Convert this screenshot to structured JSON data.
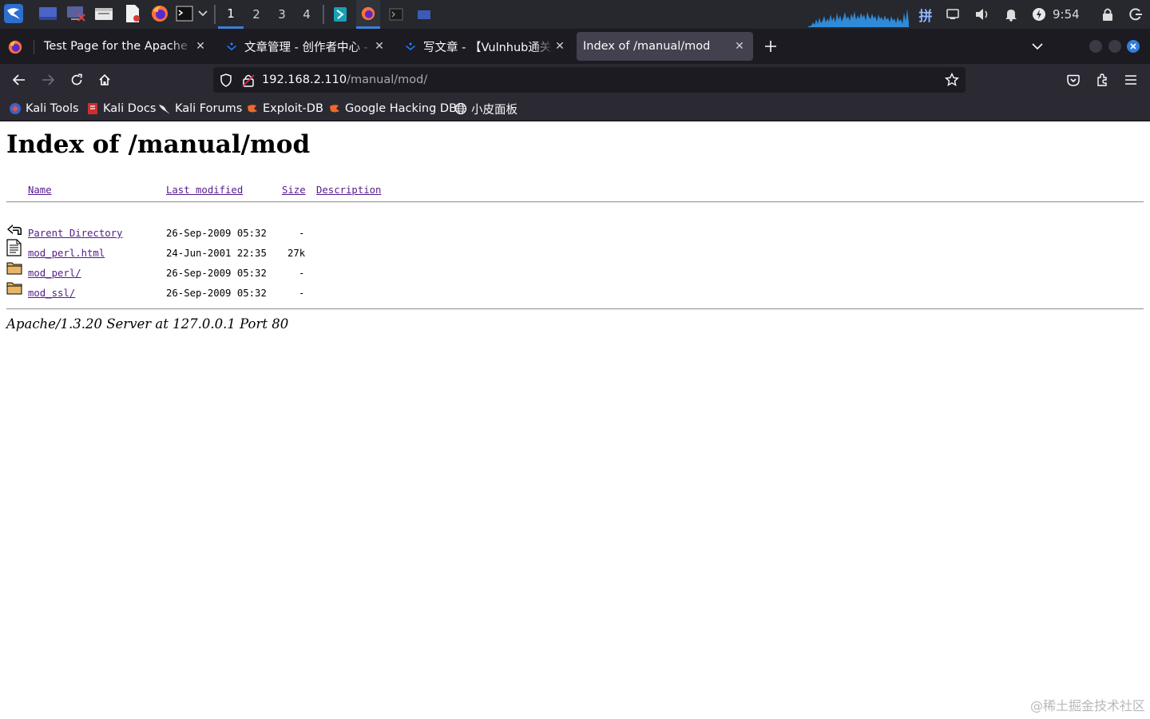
{
  "panel": {
    "workspaces": [
      "1",
      "2",
      "3",
      "4"
    ],
    "active_workspace": "1",
    "clock": "9:54",
    "launchers": [
      "kali-menu-icon",
      "show-desktop-icon",
      "remote-desktop-icon",
      "file-manager-icon",
      "text-editor-icon",
      "firefox-icon",
      "terminal-icon",
      "chevron-down-icon"
    ],
    "tray": [
      "input-method-icon",
      "display-icon",
      "volume-icon",
      "notification-bell-icon",
      "power-icon",
      "lock-icon",
      "logout-icon"
    ],
    "input_method_label": "拼",
    "accent": "#3d7fd6"
  },
  "tabs": [
    {
      "label": "Test Page for the Apache Web Server",
      "icon": "firefox-icon",
      "active": false
    },
    {
      "label": "文章管理 - 创作者中心 - 掘金",
      "icon": "juejin-icon",
      "active": false
    },
    {
      "label": "写文章 - 【Vulnhub通关】",
      "icon": "juejin-icon",
      "active": false
    },
    {
      "label": "Index of /manual/mod",
      "icon": "none",
      "active": true
    }
  ],
  "urlbar": {
    "host": "192.168.2.110",
    "path": "/manual/mod/"
  },
  "bookmarks": [
    {
      "label": "Kali Tools",
      "icon": "kali-tools-icon"
    },
    {
      "label": "Kali Docs",
      "icon": "kali-docs-icon"
    },
    {
      "label": "Kali Forums",
      "icon": "kali-forums-icon"
    },
    {
      "label": "Exploit-DB",
      "icon": "exploit-db-icon"
    },
    {
      "label": "Google Hacking DB",
      "icon": "ghdb-icon"
    },
    {
      "label": "小皮面板",
      "icon": "globe-icon"
    }
  ],
  "page": {
    "title": "Index of /manual/mod",
    "columns": {
      "name": "Name",
      "modified": "Last modified",
      "size": "Size",
      "description": "Description"
    },
    "rows": [
      {
        "name": "Parent Directory",
        "modified": "26-Sep-2009 05:32",
        "size": "-",
        "icon": "back-arrow-icon"
      },
      {
        "name": "mod_perl.html",
        "modified": "24-Jun-2001 22:35",
        "size": "27k",
        "icon": "text-file-icon"
      },
      {
        "name": "mod_perl/",
        "modified": "26-Sep-2009 05:32",
        "size": "-",
        "icon": "folder-icon"
      },
      {
        "name": "mod_ssl/",
        "modified": "26-Sep-2009 05:32",
        "size": "-",
        "icon": "folder-icon"
      }
    ],
    "address": "Apache/1.3.20 Server at 127.0.0.1 Port 80"
  },
  "watermark": "@稀土掘金技术社区"
}
